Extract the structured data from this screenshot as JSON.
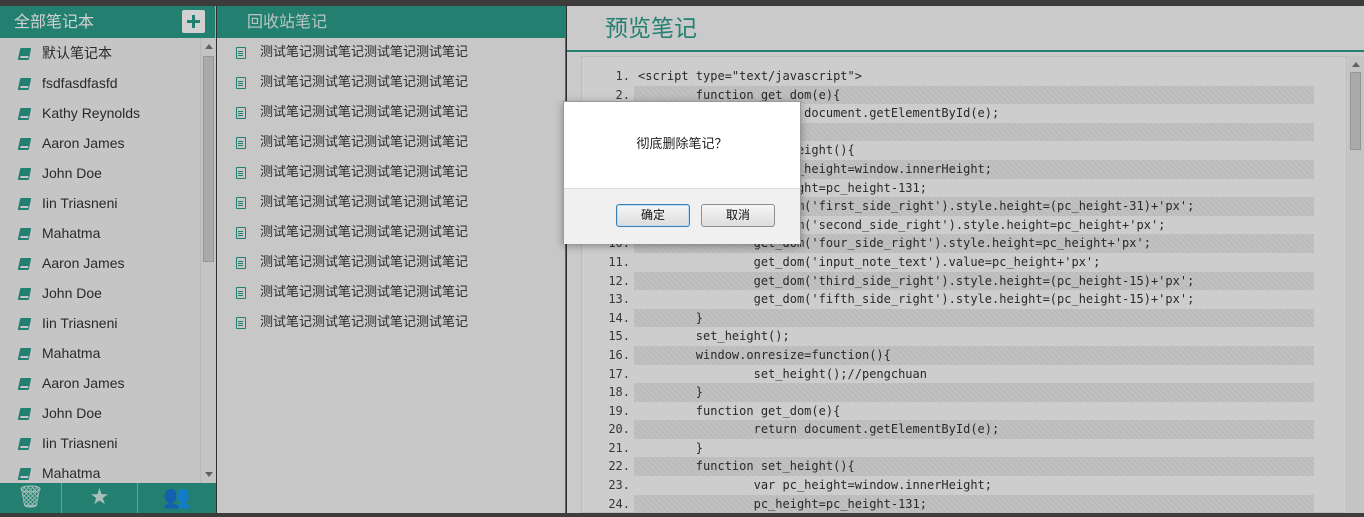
{
  "notebooks": {
    "title": "全部笔记本",
    "items": [
      "默认笔记本",
      "fsdfasdfasfd",
      "Kathy Reynolds",
      "Aaron James",
      "John Doe",
      "Iin Triasneni",
      "Mahatma",
      "Aaron James",
      "John Doe",
      "Iin Triasneni",
      "Mahatma",
      "Aaron James",
      "John Doe",
      "Iin Triasneni",
      "Mahatma"
    ]
  },
  "trash": {
    "title": "回收站笔记",
    "items": [
      "测试笔记测试笔记测试笔记测试笔记",
      "测试笔记测试笔记测试笔记测试笔记",
      "测试笔记测试笔记测试笔记测试笔记",
      "测试笔记测试笔记测试笔记测试笔记",
      "测试笔记测试笔记测试笔记测试笔记",
      "测试笔记测试笔记测试笔记测试笔记",
      "测试笔记测试笔记测试笔记测试笔记",
      "测试笔记测试笔记测试笔记测试笔记",
      "测试笔记测试笔记测试笔记测试笔记",
      "测试笔记测试笔记测试笔记测试笔记"
    ]
  },
  "preview": {
    "title": "预览笔记",
    "lines": [
      {
        "n": "1.",
        "t": "<script type=\"text/javascript\">"
      },
      {
        "n": "2.",
        "t": "        function get_dom(e){"
      },
      {
        "n": "3.",
        "t": "                return document.getElementById(e);"
      },
      {
        "n": "4.",
        "t": "        }"
      },
      {
        "n": "5.",
        "t": "        function set_height(){"
      },
      {
        "n": "6.",
        "t": "                var pc_height=window.innerHeight;"
      },
      {
        "n": "7.",
        "t": "                pc_height=pc_height-131;"
      },
      {
        "n": "8.",
        "t": "                get_dom('first_side_right').style.height=(pc_height-31)+'px';"
      },
      {
        "n": "9.",
        "t": "                get_dom('second_side_right').style.height=pc_height+'px';"
      },
      {
        "n": "10.",
        "t": "                get_dom('four_side_right').style.height=pc_height+'px';"
      },
      {
        "n": "11.",
        "t": "                get_dom('input_note_text').value=pc_height+'px';"
      },
      {
        "n": "12.",
        "t": "                get_dom('third_side_right').style.height=(pc_height-15)+'px';"
      },
      {
        "n": "13.",
        "t": "                get_dom('fifth_side_right').style.height=(pc_height-15)+'px';"
      },
      {
        "n": "14.",
        "t": "        }"
      },
      {
        "n": "15.",
        "t": "        set_height();"
      },
      {
        "n": "16.",
        "t": "        window.onresize=function(){"
      },
      {
        "n": "17.",
        "t": "                set_height();//pengchuan"
      },
      {
        "n": "18.",
        "t": "        }"
      },
      {
        "n": "19.",
        "t": "        function get_dom(e){"
      },
      {
        "n": "20.",
        "t": "                return document.getElementById(e);"
      },
      {
        "n": "21.",
        "t": "        }"
      },
      {
        "n": "22.",
        "t": "        function set_height(){"
      },
      {
        "n": "23.",
        "t": "                var pc_height=window.innerHeight;"
      },
      {
        "n": "24.",
        "t": "                pc_height=pc_height-131;"
      }
    ]
  },
  "dialog": {
    "message": "彻底删除笔记？",
    "ok_label": "确定",
    "cancel_label": "取消"
  },
  "toolbar": {
    "icons": [
      "trash-icon",
      "star-icon",
      "group-icon"
    ]
  },
  "colors": {
    "accent": "#2b9d8a"
  }
}
